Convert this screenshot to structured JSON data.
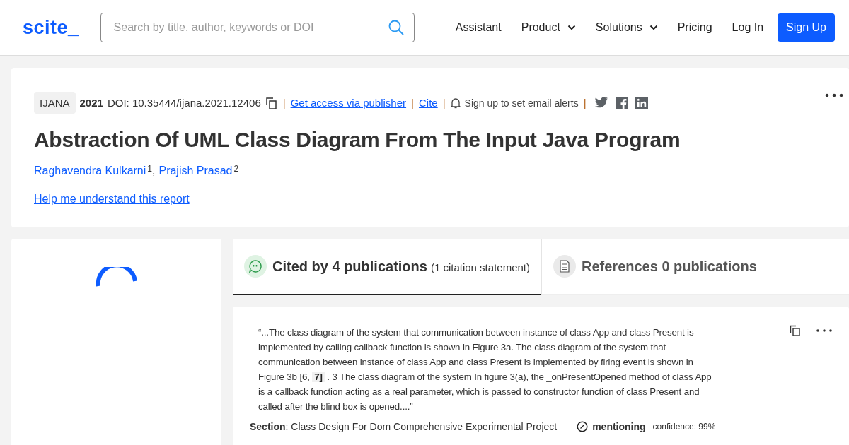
{
  "header": {
    "logo": "scite_",
    "search": {
      "placeholder": "Search by title, author, keywords or DOI"
    },
    "nav": [
      {
        "label": "Assistant",
        "has_menu": false
      },
      {
        "label": "Product",
        "has_menu": true
      },
      {
        "label": "Solutions",
        "has_menu": true
      },
      {
        "label": "Pricing",
        "has_menu": false
      },
      {
        "label": "Log In",
        "has_menu": false
      }
    ],
    "signup": "Sign Up"
  },
  "report": {
    "separator": "|",
    "journal": "IJANA",
    "year": "2021",
    "doi": "DOI: 10.35444/ijana.2021.12406",
    "access_link": "Get access via publisher",
    "cite_link": "Cite",
    "alerts": "Sign up to set email alerts",
    "title": "Abstraction Of UML Class Diagram From The Input Java Program",
    "author_separator": ",",
    "authors": [
      {
        "name": "Raghavendra Kulkarni",
        "affiliation": "1"
      },
      {
        "name": "Prajish Prasad",
        "affiliation": "2"
      }
    ],
    "help_link": "Help me understand this report"
  },
  "tabs": [
    {
      "label": "Cited by 4 publications",
      "note": "(1 citation statement)",
      "selected": true,
      "kind": "cited"
    },
    {
      "label": "References 0 publications",
      "selected": false,
      "kind": "references"
    }
  ],
  "citation": {
    "quote_before": "“...The class diagram of the system that communication between instance of class App and class Present is implemented by calling callback function is shown in Figure 3a. The class diagram of the system that communication between instance of class App and class Present is implemented by firing event is shown in Figure 3b ",
    "ref_separator": ", ",
    "refs": [
      {
        "text": "[6",
        "kind": "link"
      },
      {
        "text": "7]",
        "kind": "highlight"
      }
    ],
    "quote_after": " . 3 The class diagram of the system In figure 3(a), the _onPresentOpened method of class App is a callback function acting as a real parameter, which is passed to constructor function of class Present and called after the blind box is opened....”",
    "section_label": "Section",
    "section": ": Class Design For Dom Comprehensive Experimental Project",
    "type": "mentioning",
    "confidence": "confidence: 99%"
  }
}
